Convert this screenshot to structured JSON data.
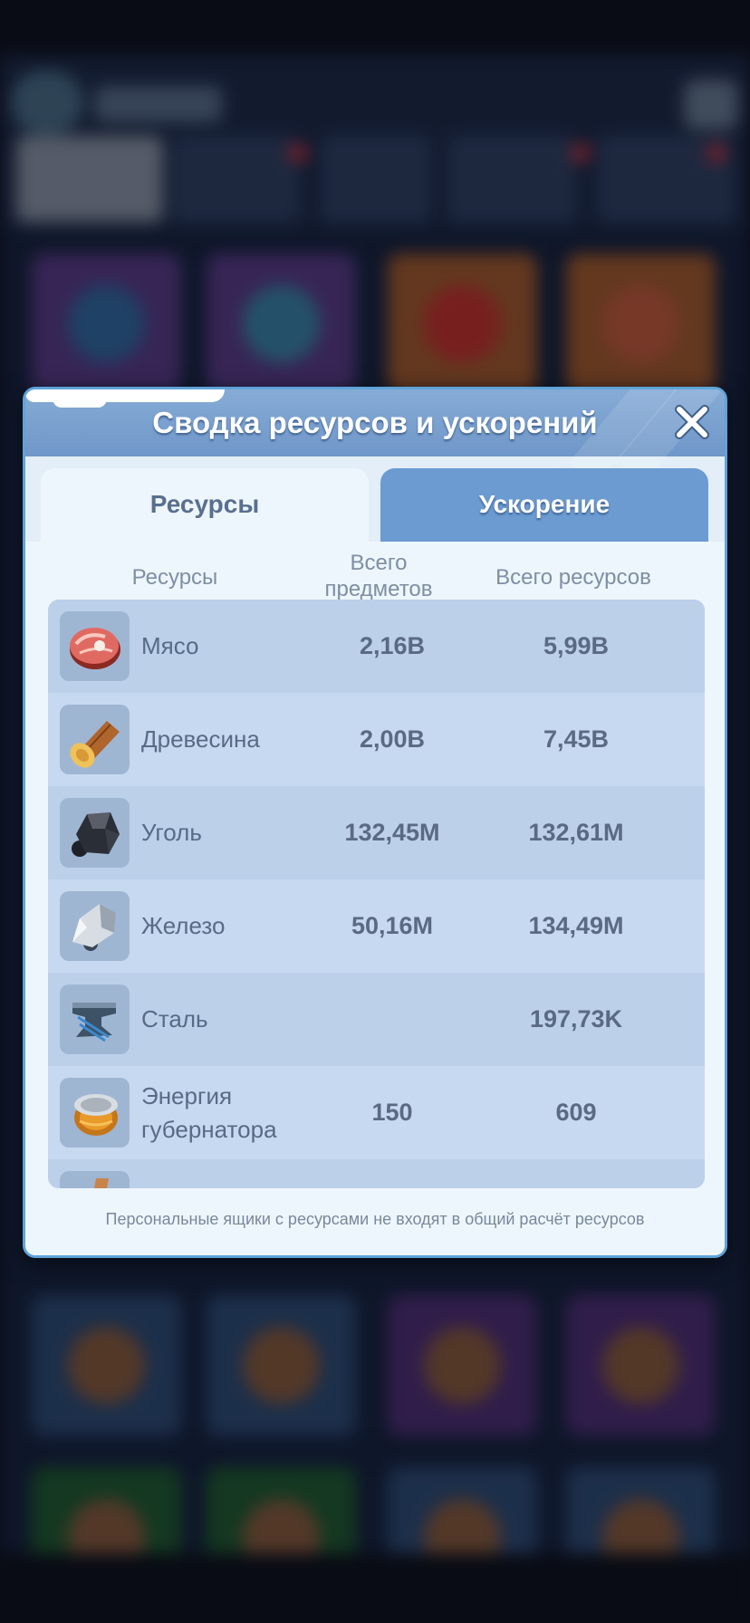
{
  "dialog": {
    "title": "Сводка ресурсов и ускорений",
    "tabs": {
      "resources": "Ресурсы",
      "speedup": "Ускорение"
    },
    "columns": {
      "name": "Ресурсы",
      "items": "Всего предметов",
      "total": "Всего ресурсов"
    },
    "rows": [
      {
        "name": "Мясо",
        "items": "2,16B",
        "total": "5,99B",
        "icon": "meat-icon"
      },
      {
        "name": "Древесина",
        "items": "2,00B",
        "total": "7,45B",
        "icon": "wood-log-icon"
      },
      {
        "name": "Уголь",
        "items": "132,45M",
        "total": "132,61M",
        "icon": "coal-icon"
      },
      {
        "name": "Железо",
        "items": "50,16M",
        "total": "134,49M",
        "icon": "iron-ore-icon"
      },
      {
        "name": "Сталь",
        "items": "",
        "total": "197,73K",
        "icon": "steel-anvil-icon"
      },
      {
        "name": "Энергия губернатора",
        "items": "150",
        "total": "609",
        "icon": "energy-can-icon"
      }
    ],
    "footnote": "Персональные ящики с ресурсами не входят в общий расчёт ресурсов",
    "colors": {
      "header": "#7aa2d0",
      "active_tab": "#edf6fc",
      "inactive_tab": "#6b9bd0",
      "frame": "#5fa3d8"
    }
  }
}
